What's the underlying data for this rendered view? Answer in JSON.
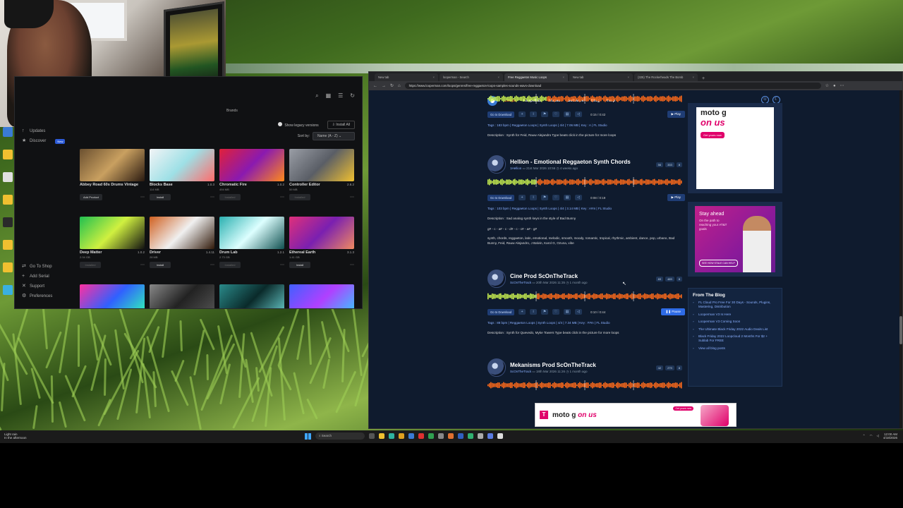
{
  "fl_window": {
    "brand_tab": "Brands",
    "show_legacy": "Show legacy versions",
    "install_all": "Install All",
    "sort_by_label": "Sort by:",
    "sort_by_value": "Name (A - Z)",
    "sidebar_top": [
      {
        "label": "Updates",
        "icon": "arrow-up-icon"
      },
      {
        "label": "Discover",
        "icon": "star-icon",
        "badge": "New"
      }
    ],
    "sidebar_bottom": [
      {
        "label": "Go To Shop",
        "icon": "cart-icon"
      },
      {
        "label": "Add Serial",
        "icon": "plus-icon"
      },
      {
        "label": "Support",
        "icon": "wrench-icon"
      },
      {
        "label": "Preferences",
        "icon": "gear-icon"
      }
    ],
    "cards": [
      {
        "name": "Abbey Road 60s Drums Vintage",
        "version": "",
        "size": "",
        "action": "Add Product",
        "muted": false,
        "colors": [
          "#6b5030",
          "#c9a060",
          "#2a1a10"
        ]
      },
      {
        "name": "Blocks Base",
        "version": "1.0.3",
        "size": "114 MB",
        "action": "Install",
        "muted": false,
        "colors": [
          "#f2f4f6",
          "#9ee0e6",
          "#ff6b6b"
        ]
      },
      {
        "name": "Chromatic Fire",
        "version": "1.0.2",
        "size": "494 MB",
        "action": "Installed",
        "muted": true,
        "colors": [
          "#e0203a",
          "#8a1ab0",
          "#ff8a1a"
        ]
      },
      {
        "name": "Controller Editor",
        "version": "2.8.2",
        "size": "59 MB",
        "action": "Installed",
        "muted": true,
        "colors": [
          "#9a9ea6",
          "#5a5e66",
          "#f0c030"
        ]
      },
      {
        "name": "Deep Matter",
        "version": "1.0.2",
        "size": "2.04 GB",
        "action": "Installed",
        "muted": true,
        "colors": [
          "#20c050",
          "#d0f040",
          "#111"
        ]
      },
      {
        "name": "Driver",
        "version": "1.4.11",
        "size": "28 MB",
        "action": "Install",
        "muted": false,
        "colors": [
          "#d06020",
          "#f0f0f0",
          "#301808"
        ]
      },
      {
        "name": "Drum Lab",
        "version": "1.2.1",
        "size": "2.73 GB",
        "action": "Installed",
        "muted": true,
        "colors": [
          "#2ab0b0",
          "#dff",
          "#105050"
        ]
      },
      {
        "name": "Ethereal Earth",
        "version": "3.1.3",
        "size": "1.41 GB",
        "action": "Install",
        "muted": false,
        "colors": [
          "#e0307a",
          "#7a20b0",
          "#f08a60"
        ]
      },
      {
        "name": "",
        "version": "",
        "size": "",
        "action": "",
        "muted": false,
        "colors": [
          "#ff30a0",
          "#3060ff",
          "#30ffb0"
        ]
      },
      {
        "name": "",
        "version": "",
        "size": "",
        "action": "",
        "muted": false,
        "colors": [
          "#888",
          "#222",
          "#555"
        ]
      },
      {
        "name": "",
        "version": "",
        "size": "",
        "action": "",
        "muted": false,
        "colors": [
          "#2a8a8a",
          "#0a2a2a",
          "#6ad0d0"
        ]
      },
      {
        "name": "",
        "version": "",
        "size": "",
        "action": "",
        "muted": false,
        "colors": [
          "#4060ff",
          "#b040ff",
          "#30d0ff"
        ]
      }
    ]
  },
  "browser": {
    "tabs": [
      {
        "title": "New tab",
        "active": false
      },
      {
        "title": "looperman - Search",
        "active": false
      },
      {
        "title": "Free Reggaeton Music Loops",
        "active": true
      },
      {
        "title": "New tab",
        "active": false
      },
      {
        "title": "(325) The Rockerheads The Bomb",
        "active": false
      }
    ],
    "url": "https://www.looperman.com/loops/genres/free-reggaeton-loops-samples-sounds-wavs-download",
    "nav": [
      "Loops",
      "Acapellas",
      "Tracks",
      "Software",
      "Blog",
      "Help"
    ],
    "loops": [
      {
        "title": "",
        "author": "",
        "date": "",
        "ago": "",
        "time": "0:15 / 0:42",
        "play": "Play",
        "playing": false,
        "stats": [],
        "tags": "Tags : 183 bpm | Reggaeton Loops | Synth Loops | 4/4 | 7.06 MB | Key : A | FL Studio",
        "desc": "Description : Synth for Feid, Rauw Alejandro Type beats click in the picture for more loops",
        "extra": ""
      },
      {
        "title": "Hellion - Emotional Reggaeton Synth Chords",
        "author": "1Hellion",
        "date": "21st Mar 2026 10:56",
        "ago": "4 weeks ago",
        "time": "0:08 / 0:19",
        "play": "Play",
        "playing": false,
        "stats": [
          "56",
          "333",
          "8"
        ],
        "tags": "Tags : 103 bpm | Reggaeton Loops | Synth Loops | 4/4 | 3.14 MB | Key : A#m | FL Studio",
        "desc": "Description : Sad analog synth keys in the style of Bad Bunny",
        "desc2": "g# - c - a# - c - d# - c - c# - a# - g#",
        "extra": "synth, chords, reggaeton, latin, emotional, melodic, smooth, moody, romantic, tropical, rhythmic, ambient, dance, pop, urbano, Bad Bunny, Feid, Rauw Alejandro, J Balvin, Karol G, Ozuna, vibe"
      },
      {
        "title": "Cine Prod ScOnTheTrack",
        "author": "ScOnTheTrack",
        "date": "20th Mar 2026 11:35",
        "ago": "1 month ago",
        "time": "0:10 / 0:44",
        "play": "Pause",
        "playing": true,
        "stats": [
          "83",
          "489",
          "8"
        ],
        "tags": "Tags : 88 bpm | Reggaeton Loops | Synth Loops | 4/4 | 7.34 MB | Key : F#m | FL Studio",
        "desc": "Description : Synth for Quevedo, Myke Towers Type beats click in the picture for more loops",
        "extra": ""
      },
      {
        "title": "Mekanisms Prod ScOnTheTrack",
        "author": "ScOnTheTrack",
        "date": "18th Mar 2026 11:26",
        "ago": "1 month ago",
        "time": "",
        "play": "",
        "playing": false,
        "stats": [
          "42",
          "279",
          "8"
        ],
        "tags": "",
        "desc": "",
        "extra": ""
      }
    ],
    "download_label": "Go to Download",
    "ad1": {
      "brand": "moto g",
      "slogan": "on us",
      "cta": "Get yours now"
    },
    "ad2": {
      "headline": "Stay ahead",
      "sub": "On the path to reaching your AT&T goals",
      "cta": "SEE HOW STALE CAN HELP"
    },
    "blog": {
      "title": "From The Blog",
      "items": [
        "FL Cloud Pro Free For 30 Days - Sounds, Plugins, Mastering, Distribution",
        "Looperman V3 Is Here",
        "Looperman V3 Coming Soon",
        "The Ultimate Black Friday 2022 Audio Deals List",
        "Black Friday 2022 Loopcloud 2 Months For $2 + Sublab For FREE",
        "View all blog posts"
      ]
    },
    "bottom_ad": {
      "brand": "moto g",
      "slogan": "on us",
      "cta": "Get yours now"
    }
  },
  "taskbar": {
    "weather_1": "Light rain",
    "weather_2": "In the afternoon",
    "search": "Search",
    "time": "12:00 AM",
    "date": "4/18/2026"
  }
}
